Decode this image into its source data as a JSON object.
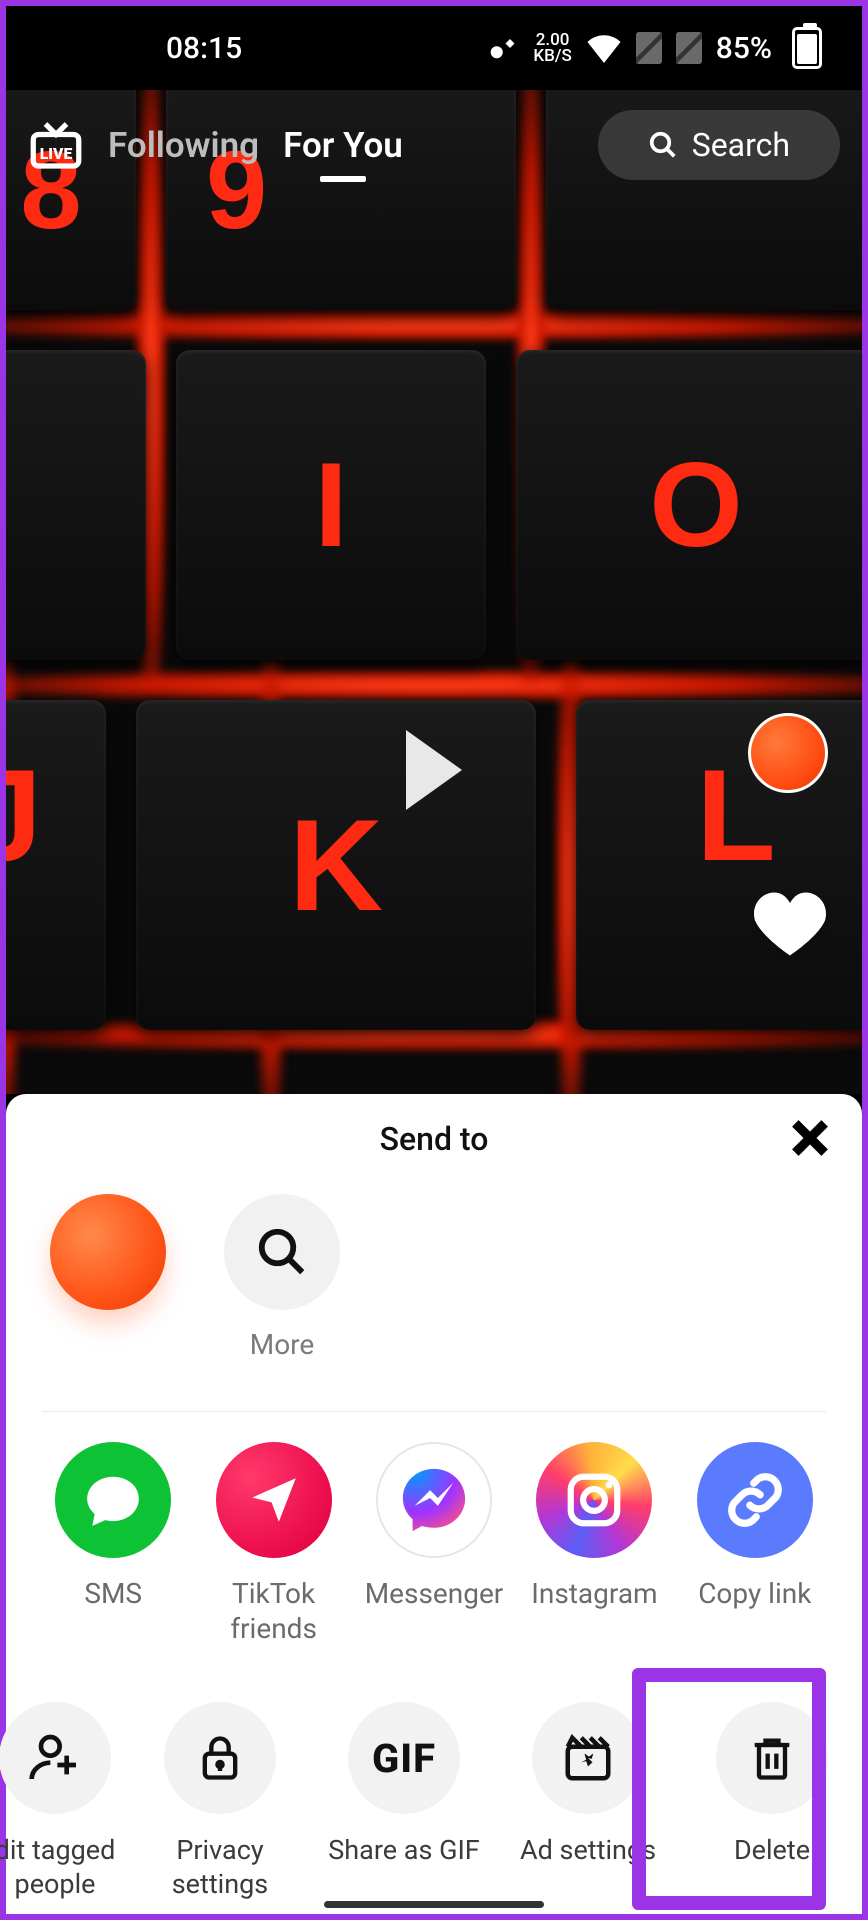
{
  "status": {
    "time": "08:15",
    "net_speed_top": "2.00",
    "net_speed_bottom": "KB/S",
    "battery_pct": "85%"
  },
  "top": {
    "tab_following": "Following",
    "tab_for_you": "For You",
    "search_label": "Search"
  },
  "sheet": {
    "title": "Send to",
    "more_label": "More"
  },
  "share": {
    "sms": "SMS",
    "friends": "TikTok friends",
    "messenger": "Messenger",
    "instagram": "Instagram",
    "copylink": "Copy link"
  },
  "actions": {
    "tagged": "dit tagged people",
    "privacy": "Privacy settings",
    "gif": "Share as GIF",
    "gif_icon": "GIF",
    "ads": "Ad settings",
    "delete": "Delete"
  }
}
